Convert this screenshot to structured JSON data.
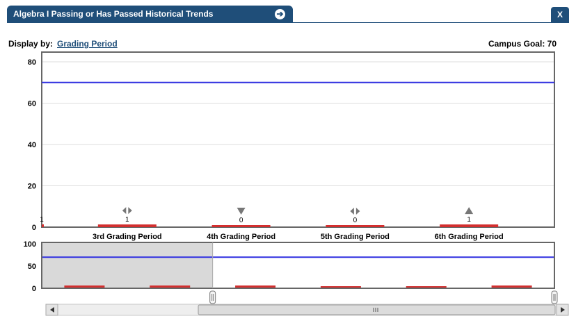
{
  "window": {
    "title": "Algebra I Passing or Has Passed Historical Trends",
    "go_icon": "arrow-right-circle-icon",
    "close_label": "X"
  },
  "controls": {
    "display_by_label": "Display by:",
    "display_by_value": "Grading Period",
    "campus_goal_label": "Campus Goal: 70"
  },
  "colors": {
    "bar": "#d32f2f",
    "goal_line": "#2f2fe0",
    "frame": "#666666",
    "selection": "#d9d9d9"
  },
  "chart_data": {
    "type": "bar",
    "categories": [
      "3rd Grading Period",
      "4th Grading Period",
      "5th Grading Period",
      "6th Grading Period"
    ],
    "values": [
      1,
      0,
      0,
      1
    ],
    "data_labels": [
      "1",
      "0",
      "0",
      "1"
    ],
    "trend_icons": [
      "left-right-arrows-icon",
      "down-triangle-icon",
      "left-right-arrows-icon",
      "up-triangle-icon"
    ],
    "goal": 70,
    "ylim": [
      0,
      80
    ],
    "yticks": [
      0,
      20,
      40,
      60,
      80
    ],
    "grid": true,
    "navigator": {
      "ylim": [
        0,
        100
      ],
      "yticks": [
        0,
        50,
        100
      ],
      "values": [
        1,
        1,
        1,
        0,
        0,
        1
      ],
      "selected_from": 2,
      "selected_to": 6
    }
  }
}
